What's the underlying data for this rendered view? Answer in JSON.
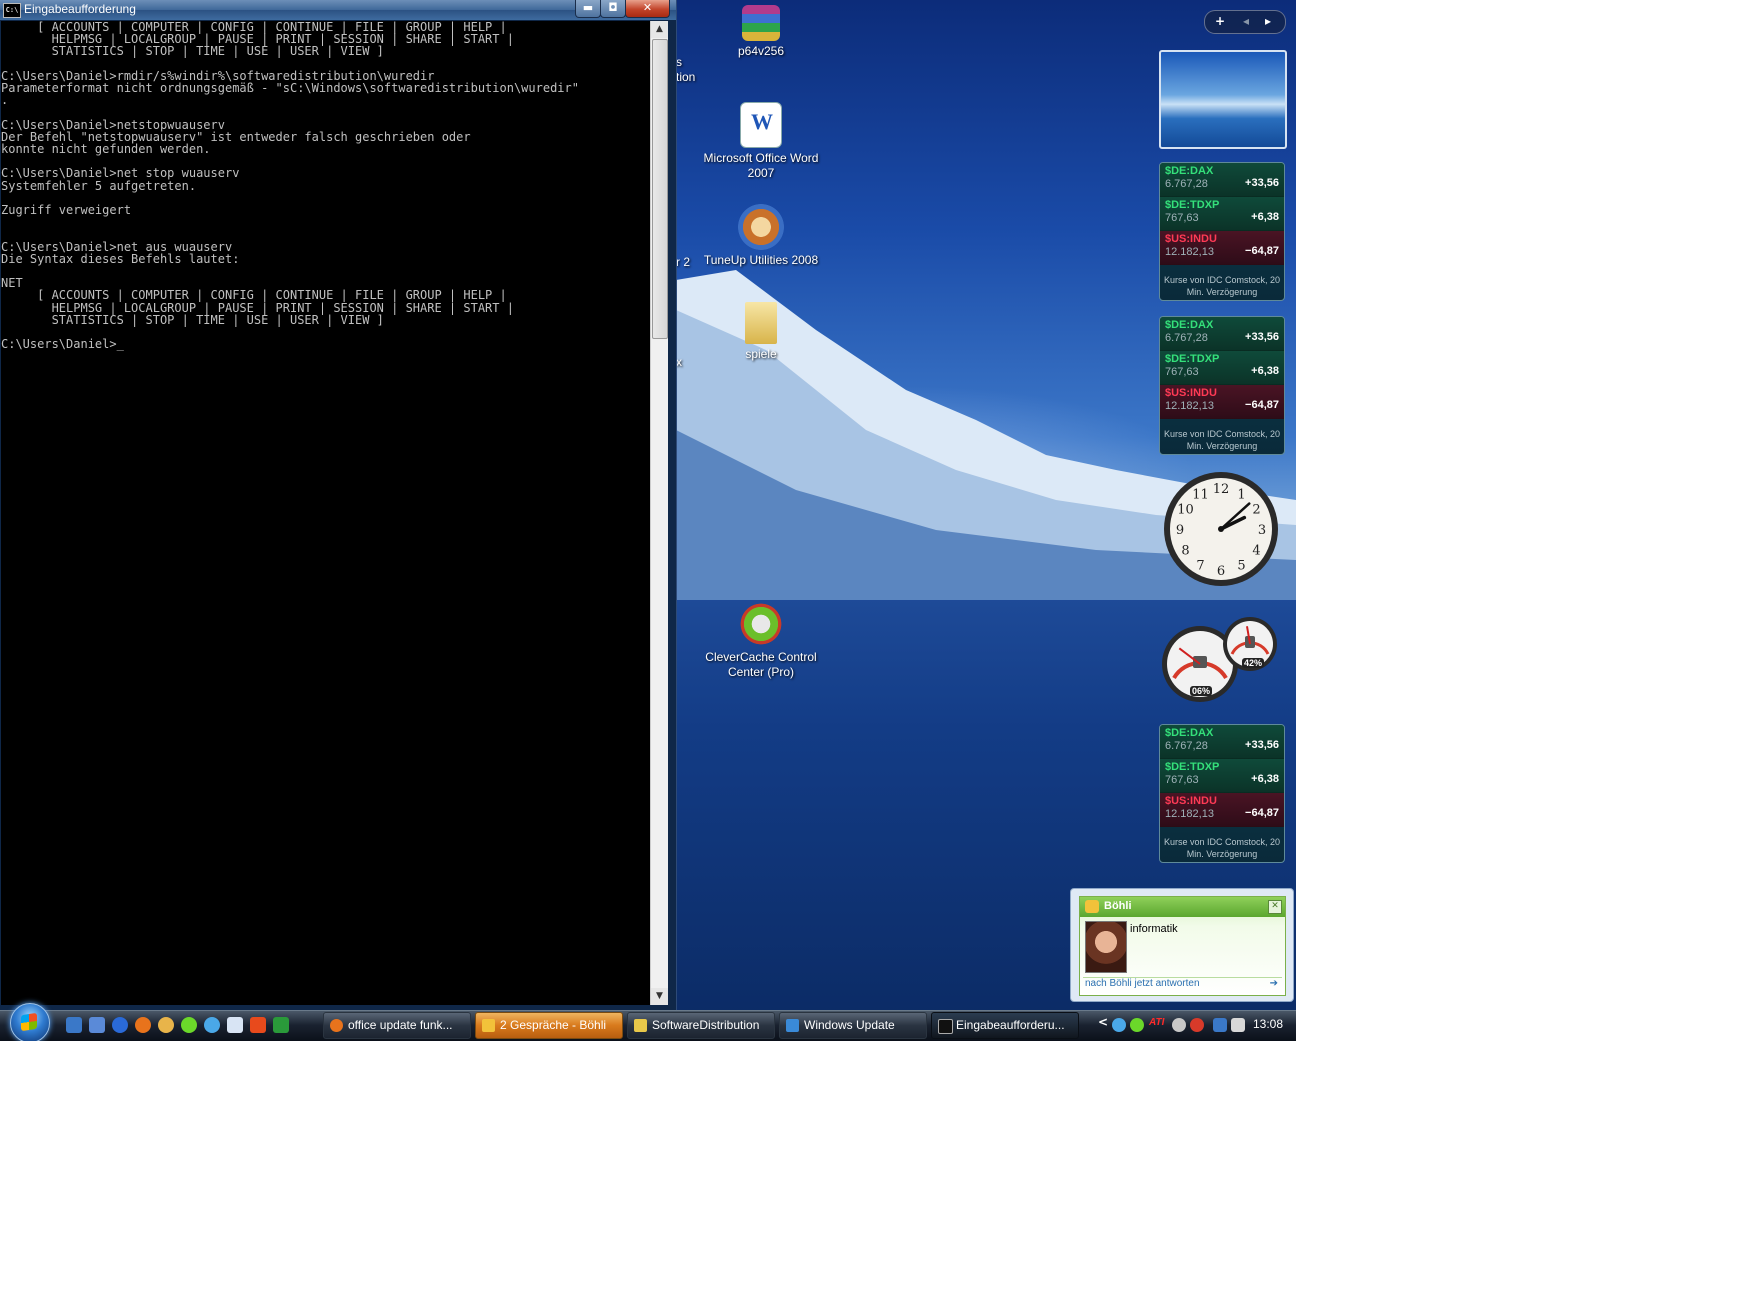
{
  "cmd": {
    "title": "Eingabeaufforderung",
    "icon_text": "C:\\",
    "buttons": {
      "minimize": "▬",
      "maximize": "◘",
      "close": "✕"
    },
    "lines": [
      "     [ ACCOUNTS | COMPUTER | CONFIG | CONTINUE | FILE | GROUP | HELP |",
      "       HELPMSG | LOCALGROUP | PAUSE | PRINT | SESSION | SHARE | START |",
      "       STATISTICS | STOP | TIME | USE | USER | VIEW ]",
      "",
      "C:\\Users\\Daniel>rmdir/s%windir%\\softwaredistribution\\wuredir",
      "Parameterformat nicht ordnungsgemäß - \"sC:\\Windows\\softwaredistribution\\wuredir\"",
      ".",
      "",
      "C:\\Users\\Daniel>netstopwuauserv",
      "Der Befehl \"netstopwuauserv\" ist entweder falsch geschrieben oder",
      "konnte nicht gefunden werden.",
      "",
      "C:\\Users\\Daniel>net stop wuauserv",
      "Systemfehler 5 aufgetreten.",
      "",
      "Zugriff verweigert",
      "",
      "",
      "C:\\Users\\Daniel>net aus wuauserv",
      "Die Syntax dieses Befehls lautet:",
      "",
      "NET",
      "     [ ACCOUNTS | COMPUTER | CONFIG | CONTINUE | FILE | GROUP | HELP |",
      "       HELPMSG | LOCALGROUP | PAUSE | PRINT | SESSION | SHARE | START |",
      "       STATISTICS | STOP | TIME | USE | USER | VIEW ]",
      "",
      "C:\\Users\\Daniel>_"
    ],
    "scroll_up": "▲",
    "scroll_down": "▼"
  },
  "desktop": {
    "icons": [
      {
        "label": "p64v256",
        "icon": "winrar-archive-icon"
      },
      {
        "label": "Microsoft Office Word 2007",
        "icon": "word-icon"
      },
      {
        "label": "TuneUp Utilities 2008",
        "icon": "tuneup-icon"
      },
      {
        "label": "spiele",
        "icon": "folder-icon"
      },
      {
        "label": "CleverCache Control Center (Pro)",
        "icon": "clevercache-icon"
      }
    ],
    "clipped_labels": [
      "s",
      "tion",
      "r 2",
      "x"
    ]
  },
  "sidebar": {
    "control": {
      "add": "+",
      "prev": "◂",
      "next": "▸"
    },
    "stocks_note": "Kurse von IDC Comstock, 20 Min. Verzögerung",
    "stocks": [
      {
        "symbol": "$DE:DAX",
        "price": "6.767,28",
        "change": "+33,56",
        "trend": "up"
      },
      {
        "symbol": "$DE:TDXP",
        "price": "767,63",
        "change": "+6,38",
        "trend": "up"
      },
      {
        "symbol": "$US:INDU",
        "price": "12.182,13",
        "change": "−64,87",
        "trend": "down"
      }
    ],
    "clock": {
      "hour": 2,
      "minute": 8,
      "numerals": [
        "12",
        "1",
        "2",
        "3",
        "4",
        "5",
        "6",
        "7",
        "8",
        "9",
        "10",
        "11"
      ]
    },
    "meters": {
      "cpu": "06%",
      "memory": "42%",
      "cpu_value": 6,
      "memory_value": 42
    }
  },
  "chat": {
    "name": "Böhli",
    "message": "informatik",
    "reply": "nach Böhli jetzt antworten",
    "reply_arrow": "➔",
    "close": "✕"
  },
  "taskbar": {
    "tasks": [
      {
        "label": "office update funk...",
        "icon_color": "#e8731c",
        "state": "normal"
      },
      {
        "label": "2 Gespräche - Böhli",
        "icon_color": "#f2c23a",
        "state": "flash"
      },
      {
        "label": "SoftwareDistribution",
        "icon_color": "#e8c84a",
        "state": "normal"
      },
      {
        "label": "Windows Update",
        "icon_color": "#3a8ad8",
        "state": "normal"
      },
      {
        "label": "Eingabeaufforderu...",
        "icon_color": "#222222",
        "state": "active"
      }
    ],
    "tray_expand": "<",
    "tray_ati": "ATI",
    "time": "13:08"
  }
}
